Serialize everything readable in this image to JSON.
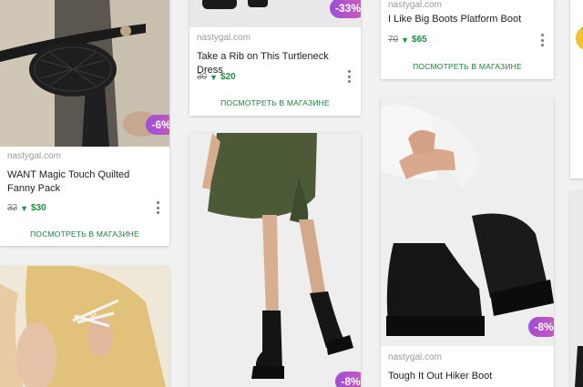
{
  "colors": {
    "accent_green": "#188038",
    "badge_gradient_start": "#9c4fd6",
    "badge_gradient_end": "#d05ab8"
  },
  "cards": [
    {
      "id": "fanny-pack",
      "discount": "-6%",
      "store": "nastygal.com",
      "title": "WANT Magic Touch Quilted Fanny Pack",
      "old_price": "32",
      "new_price": "$30",
      "shop_label": "ПОСМОТРЕТЬ В МАГАЗИНЕ"
    },
    {
      "id": "turtleneck-dress",
      "discount": "-33%",
      "store": "nastygal.com",
      "title": "Take a Rib on This Turtleneck Dress",
      "old_price": "30",
      "new_price": "$20",
      "shop_label": "ПОСМОТРЕТЬ В МАГАЗИНЕ"
    },
    {
      "id": "platform-boot",
      "store": "nastygal.com",
      "title": "I Like Big Boots Platform Boot",
      "old_price": "70",
      "new_price": "$65",
      "shop_label": "ПОСМОТРЕТЬ В МАГАЗИНЕ"
    },
    {
      "id": "hiker-boot",
      "discount": "-8%",
      "store": "nastygal.com",
      "title": "Tough It Out Hiker Boot"
    },
    {
      "id": "green-dress-boots",
      "discount": "-8%"
    },
    {
      "id": "hair-clip"
    }
  ],
  "icons": {
    "price_down": "▼",
    "more": "more-vert-icon"
  }
}
